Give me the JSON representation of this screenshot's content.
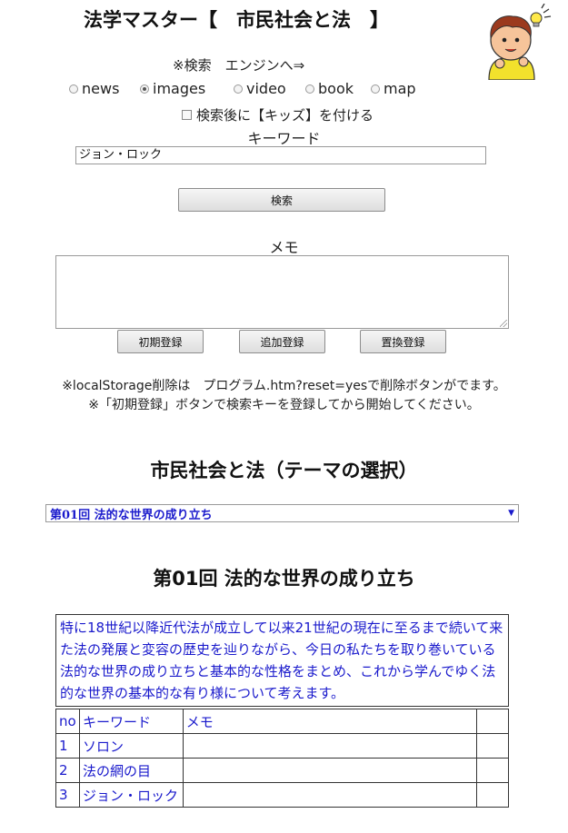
{
  "header": {
    "title": "法学マスター【　市民社会と法　】"
  },
  "search": {
    "hint": "※検索　エンジンへ⇒",
    "engines": [
      {
        "label": "news",
        "checked": false
      },
      {
        "label": "images",
        "checked": true
      },
      {
        "label": "video",
        "checked": false
      },
      {
        "label": "book",
        "checked": false
      },
      {
        "label": "map",
        "checked": false
      }
    ],
    "kids_label": "検索後に【キッズ】を付ける",
    "keyword_label": "キーワード",
    "keyword_value": "ジョン・ロック",
    "search_button": "検索"
  },
  "memo": {
    "label": "メモ",
    "value": "",
    "buttons": {
      "initial": "初期登録",
      "add": "追加登録",
      "replace": "置換登録"
    },
    "note1": "※localStorage削除は　プログラム.htm?reset=yesで削除ボタンがでます。",
    "note2": "※「初期登録」ボタンで検索キーを登録してから開始してください。"
  },
  "theme": {
    "heading": "市民社会と法（テーマの選択）",
    "selected": "第01回 法的な世界の成り立ち"
  },
  "lesson": {
    "title": "第01回 法的な世界の成り立ち",
    "description": "特に18世紀以降近代法が成立して以来21世紀の現在に至るまで続いて来た法の発展と変容の歴史を辿りながら、今日の私たちを取り巻いている法的な世界の成り立ちと基本的な性格をまとめ、これから学んでゆく法的な世界の基本的な有り様について考えます。",
    "table": {
      "headers": {
        "no": "no",
        "keyword": "キーワード",
        "memo": "メモ"
      },
      "rows": [
        {
          "no": "1",
          "keyword": "ソロン",
          "memo": ""
        },
        {
          "no": "2",
          "keyword": "法の網の目",
          "memo": ""
        },
        {
          "no": "3",
          "keyword": "ジョン・ロック",
          "memo": ""
        }
      ]
    }
  },
  "colors": {
    "link_blue": "#1a1acc"
  },
  "icons": {
    "mascot": "boy-with-lightbulb-icon"
  }
}
